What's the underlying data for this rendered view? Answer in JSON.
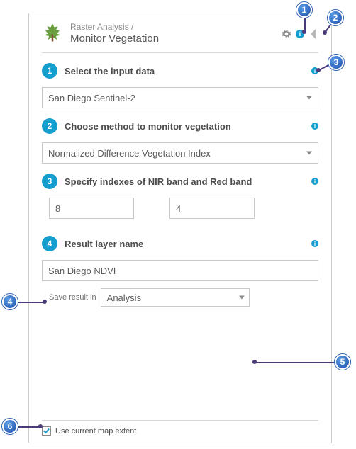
{
  "header": {
    "breadcrumb": "Raster Analysis /",
    "title": "Monitor Vegetation"
  },
  "steps": {
    "s1": {
      "num": "1",
      "title": "Select the input data",
      "value": "San Diego Sentinel-2"
    },
    "s2": {
      "num": "2",
      "title": "Choose method to monitor vegetation",
      "value": "Normalized Difference Vegetation Index"
    },
    "s3": {
      "num": "3",
      "title": "Specify indexes of NIR band and Red band",
      "nir": "8",
      "red": "4"
    },
    "s4": {
      "num": "4",
      "title": "Result layer name",
      "value": "San Diego NDVI"
    }
  },
  "save": {
    "label": "Save result in",
    "value": "Analysis"
  },
  "footer": {
    "extent_label": "Use current map extent",
    "checked": true
  },
  "callouts": {
    "c1": "1",
    "c2": "2",
    "c3": "3",
    "c4": "4",
    "c5": "5",
    "c6": "6"
  }
}
